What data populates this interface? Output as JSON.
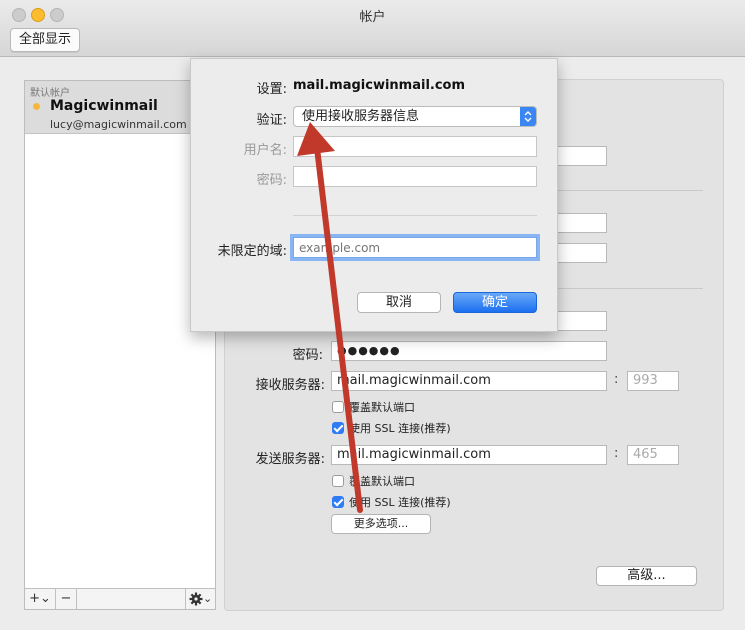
{
  "window": {
    "title": "帐户",
    "show_all": "全部显示"
  },
  "account_list": {
    "section_label": "默认帐户",
    "account_name": "Magicwinmail",
    "account_email": "lucy@magicwinmail.com",
    "add_label": "+⌄",
    "remove_label": "−",
    "gear_label": "⌄"
  },
  "main": {
    "password_label": "密码:",
    "password_value": "●●●●●●",
    "incoming_label": "接收服务器:",
    "incoming_server": "mail.magicwinmail.com",
    "incoming_port": "993",
    "incoming_override": "覆盖默认端口",
    "incoming_ssl": "使用 SSL 连接(推荐)",
    "outgoing_label": "发送服务器:",
    "outgoing_server": "mail.magicwinmail.com",
    "outgoing_port": "465",
    "outgoing_override": "覆盖默认端口",
    "outgoing_ssl": "使用 SSL 连接(推荐)",
    "more_options": "更多选项...",
    "advanced": "高级..."
  },
  "sheet": {
    "settings_label": "设置:",
    "settings_value": "mail.magicwinmail.com",
    "auth_label": "验证:",
    "auth_value": "使用接收服务器信息",
    "username_label": "用户名:",
    "password_label": "密码:",
    "domain_label": "未限定的域:",
    "domain_placeholder": "example.com",
    "cancel": "取消",
    "ok": "确定"
  },
  "colors": {
    "accent": "#2f7cf6",
    "arrow": "#c0392b"
  }
}
